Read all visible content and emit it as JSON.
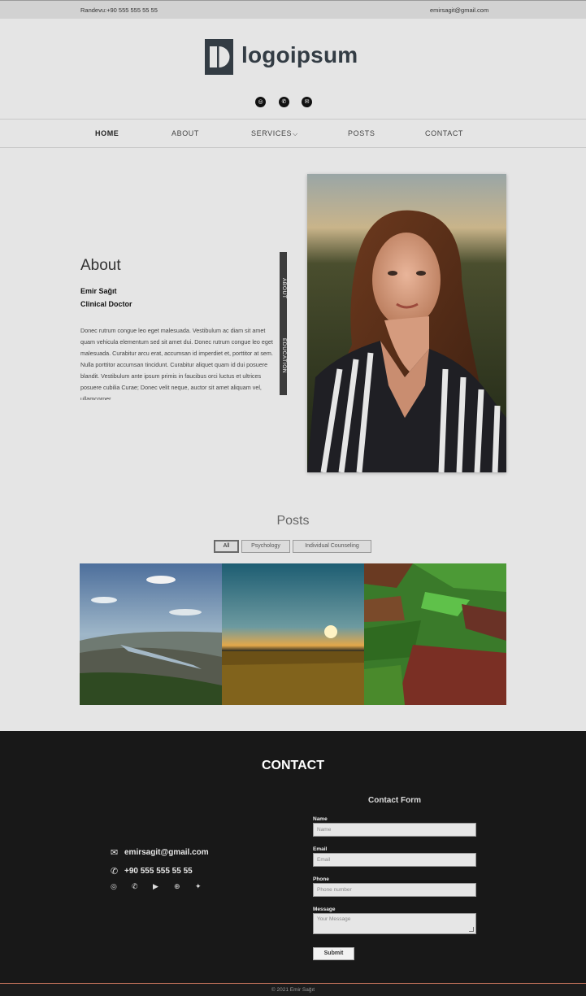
{
  "topbar": {
    "appointment": "Randevu:+90 555 555 55 55",
    "email": "emirsagit@gmail.com"
  },
  "brand": {
    "logo_text": "logoipsum"
  },
  "social_top": [
    {
      "icon": "instagram-icon",
      "glyph": "◎"
    },
    {
      "icon": "phone-icon",
      "glyph": "✆"
    },
    {
      "icon": "mail-icon",
      "glyph": "✉"
    }
  ],
  "nav": {
    "items": [
      {
        "label": "HOME"
      },
      {
        "label": "ABOUT"
      },
      {
        "label": "SERVICES"
      },
      {
        "label": "POSTS"
      },
      {
        "label": "CONTACT"
      }
    ],
    "chevron": "⌵"
  },
  "about": {
    "title": "About",
    "name": "Emir Sağıt",
    "role": "Clinical Doctor",
    "bio": "Donec rutrum congue leo eget malesuada. Vestibulum ac diam sit amet quam vehicula elementum sed sit amet dui. Donec rutrum congue leo eget malesuada. Curabitur arcu erat, accumsan id imperdiet et, porttitor at sem. Nulla porttitor accumsan tincidunt. Curabitur aliquet quam id dui posuere blandit. Vestibulum ante ipsum primis in faucibus orci luctus et ultrices posuere cubilia Curae; Donec velit neque, auctor sit amet aliquam vel, ullamcorper",
    "tabs": [
      "ABOUT",
      "EDUCATION"
    ]
  },
  "posts": {
    "title": "Posts",
    "filters": [
      "All",
      "Psychology",
      "Individual Counseling"
    ]
  },
  "contact": {
    "title": "CONTACT",
    "email": "emirsagit@gmail.com",
    "phone": "+90 555 555 55 55",
    "socials": [
      "instagram-icon",
      "whatsapp-icon",
      "youtube-icon",
      "pinterest-icon",
      "twitter-icon"
    ],
    "form": {
      "title": "Contact Form",
      "name_label": "Name",
      "name_placeholder": "Name",
      "email_label": "Email",
      "email_placeholder": "Email",
      "phone_label": "Phone",
      "phone_placeholder": "Phone number",
      "message_label": "Message",
      "message_placeholder": "Your Message",
      "submit": "Submit"
    }
  },
  "footer": {
    "copyright": "© 2021 Emir Sağıt"
  },
  "colors": {
    "footer_bg": "#181818",
    "page_bg": "#e5e5e5",
    "accent_line": "#c0705a"
  }
}
